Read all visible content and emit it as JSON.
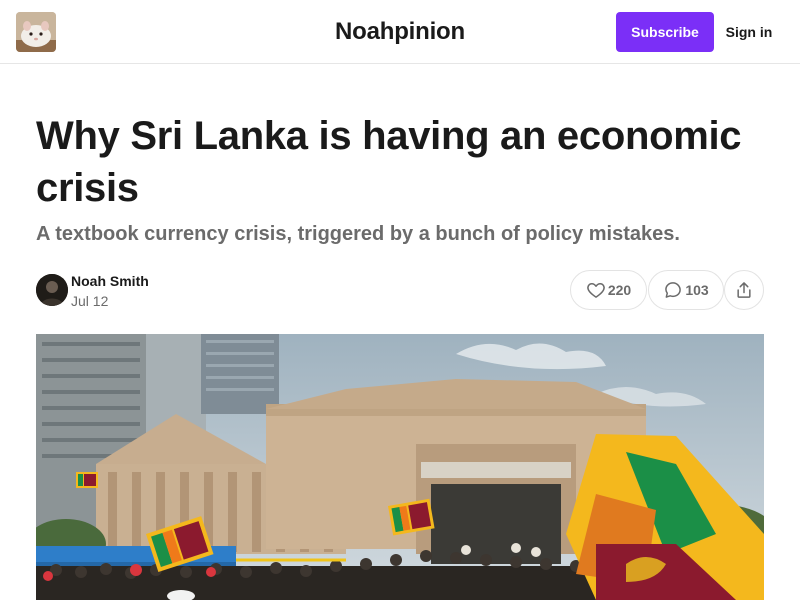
{
  "header": {
    "publication_name": "Noahpinion",
    "subscribe_label": "Subscribe",
    "signin_label": "Sign in"
  },
  "post": {
    "title": "Why Sri Lanka is having an economic crisis",
    "subtitle": "A textbook currency crisis, triggered by a bunch of policy mistakes.",
    "author": "Noah Smith",
    "date": "Jul 12",
    "likes": "220",
    "comments": "103"
  },
  "icons": {
    "like": "heart-icon",
    "comment": "speech-bubble-icon",
    "share": "share-icon"
  },
  "colors": {
    "accent": "#7b2ff7",
    "text": "#1a1a1a",
    "muted": "#6b6b6b",
    "border": "#e3e3e3"
  }
}
